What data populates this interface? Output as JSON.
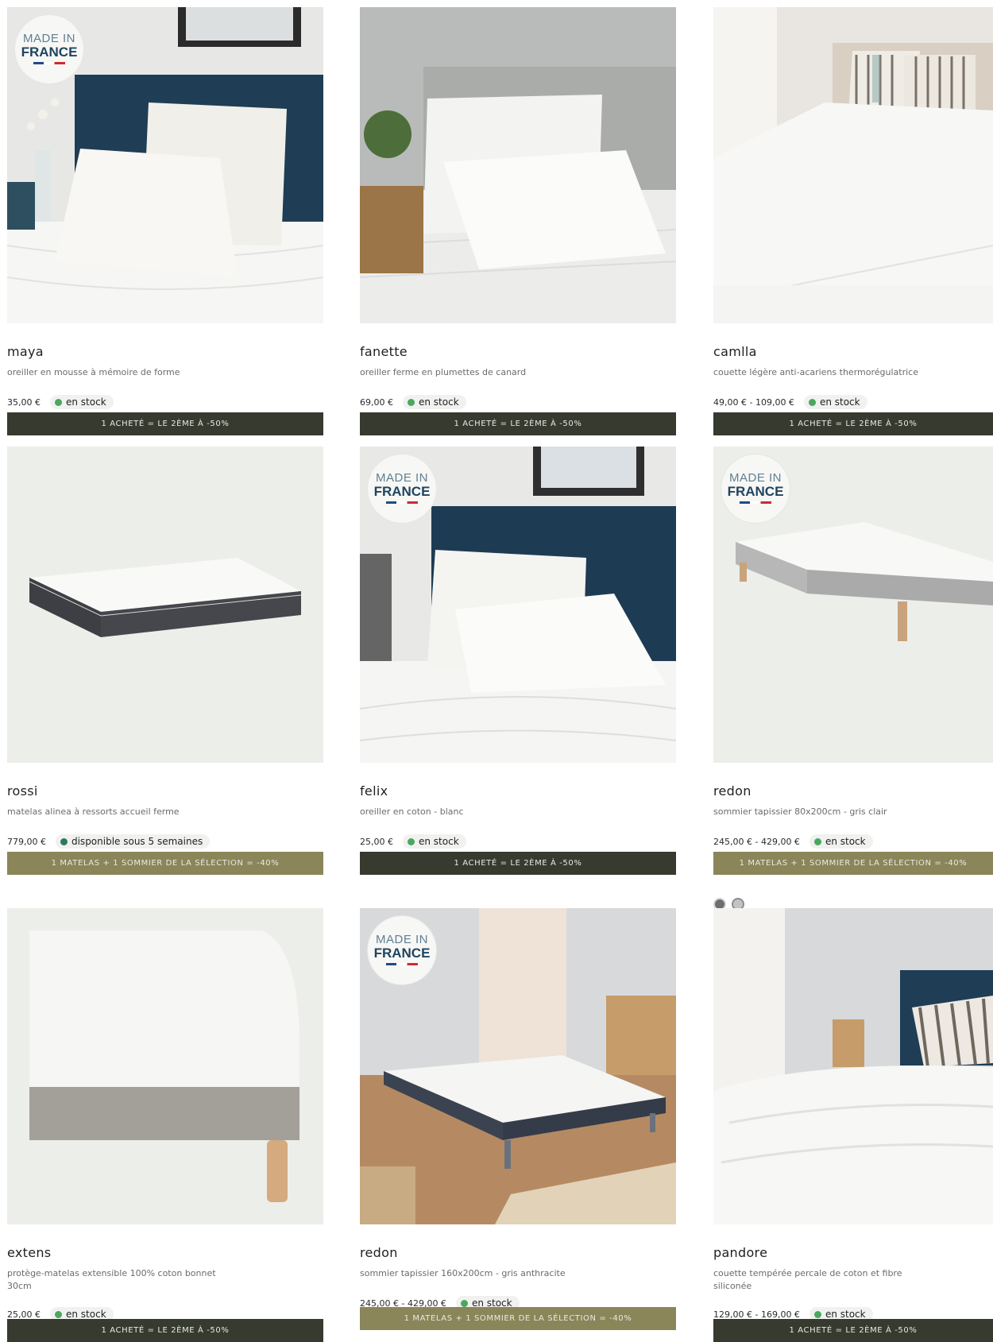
{
  "badge": {
    "line1": "MADE IN",
    "line2": "FRANCE"
  },
  "colors": {
    "in_stock_dot": "#49a860",
    "promo_dark": "#363a2f",
    "promo_olive": "#8a8659"
  },
  "products": [
    {
      "name": "maya",
      "desc": "oreiller en mousse à mémoire de forme",
      "price": "35,00 €",
      "stock": "en stock",
      "promo": "1 ACHETÉ = LE 2ÈME À -50%",
      "made_in_france": true
    },
    {
      "name": "fanette",
      "desc": "oreiller ferme en plumettes de canard",
      "price": "69,00 €",
      "stock": "en stock",
      "promo": "1 ACHETÉ = LE 2ÈME À -50%",
      "made_in_france": false
    },
    {
      "name": "camlla",
      "desc": "couette légère anti-acariens thermorégulatrice",
      "price": "49,00 € - 109,00 €",
      "stock": "en stock",
      "promo": "1 ACHETÉ = LE 2ÈME À -50%",
      "made_in_france": false
    },
    {
      "name": "rossi",
      "desc": "matelas alinea à ressorts accueil ferme",
      "price": "779,00 €",
      "stock": "disponible sous 5 semaines",
      "promo": "1 MATELAS + 1 SOMMIER DE LA SÉLECTION = -40%",
      "made_in_france": false
    },
    {
      "name": "felix",
      "desc": "oreiller en coton - blanc",
      "price": "25,00 €",
      "stock": "en stock",
      "promo": "1 ACHETÉ = LE 2ÈME À -50%",
      "made_in_france": true
    },
    {
      "name": "redon",
      "desc": "sommier tapissier 80x200cm - gris clair",
      "price": "245,00 € - 429,00 €",
      "stock": "en stock",
      "promo": "1 MATELAS + 1 SOMMIER DE LA SÉLECTION = -40%",
      "made_in_france": true,
      "swatches": [
        "gris foncé",
        "gris clair"
      ]
    },
    {
      "name": "extens",
      "desc": "protège-matelas extensible 100% coton bonnet 30cm",
      "price": "25,00 €",
      "stock": "en stock",
      "promo": "1 ACHETÉ = LE 2ÈME À -50%",
      "made_in_france": false
    },
    {
      "name": "redon",
      "desc": "sommier tapissier 160x200cm - gris anthracite",
      "price": "245,00 € - 429,00 €",
      "stock": "en stock",
      "promo": "1 MATELAS + 1 SOMMIER DE LA SÉLECTION = -40%",
      "made_in_france": true
    },
    {
      "name": "pandore",
      "desc": "couette tempérée percale de coton et fibre siliconée",
      "price": "129,00 € - 169,00 €",
      "stock": "en stock",
      "promo": "1 ACHETÉ = LE 2ÈME À -50%",
      "made_in_france": false
    }
  ]
}
